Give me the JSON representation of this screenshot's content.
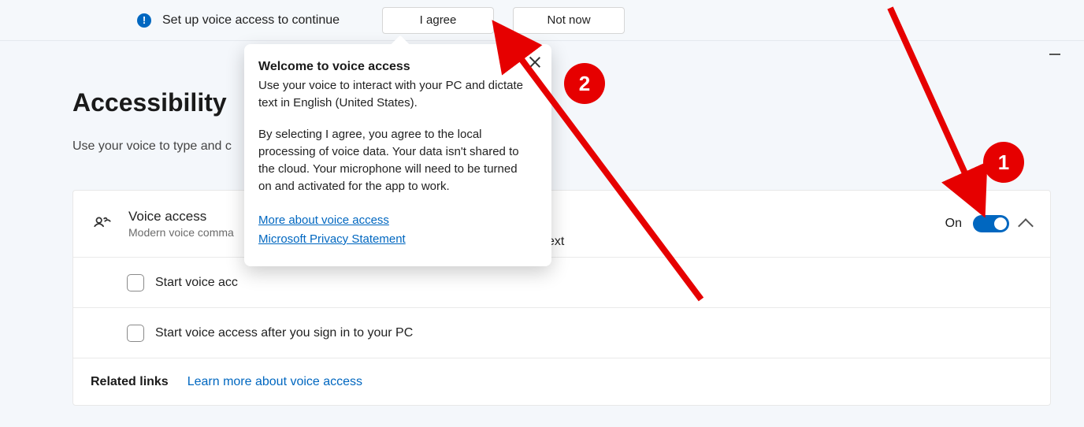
{
  "notification": {
    "message": "Set up voice access to continue",
    "agree": "I agree",
    "not_now": "Not now"
  },
  "page": {
    "title": "Accessibility",
    "subtitle": "Use your voice to type and c"
  },
  "card": {
    "title": "Voice access",
    "sub": "Modern voice comma",
    "floating": "ext",
    "toggle_state": "On",
    "row1": "Start voice acc",
    "row2": "Start voice access after you sign in to your PC",
    "related_label": "Related links",
    "related_link": "Learn more about voice access"
  },
  "popover": {
    "title": "Welcome to voice access",
    "p1": "Use your voice to interact with your PC and dictate text in English (United States).",
    "p2": "By selecting I agree, you agree to the local processing of voice data. Your data isn't shared to the cloud. Your microphone will need to be turned on and activated for the app to work.",
    "link1": "More about voice access",
    "link2": "Microsoft Privacy Statement"
  },
  "annotations": {
    "color": "#e60000",
    "badges": [
      "1",
      "2"
    ]
  }
}
